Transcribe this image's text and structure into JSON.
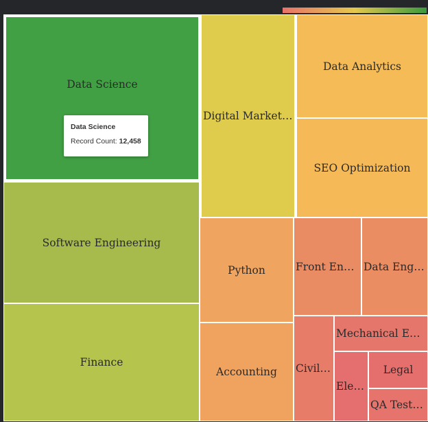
{
  "colors": {
    "background": "#252629",
    "legend_gradient": [
      "#e8736a",
      "#e5c84c",
      "#3b9a3e"
    ]
  },
  "chart_data": {
    "type": "treemap",
    "metric": "Record Count",
    "legend": "color-scale",
    "tiles": [
      {
        "label": "Data Science",
        "color": "#42a044",
        "selected": true
      },
      {
        "label": "Software Engineering",
        "color": "#a6bb4b"
      },
      {
        "label": "Finance",
        "color": "#b5c44c"
      },
      {
        "label": "Digital Marketing",
        "color": "#dfcc4d"
      },
      {
        "label": "Data Analytics",
        "color": "#f5bb57"
      },
      {
        "label": "SEO Optimization",
        "color": "#f5b958"
      },
      {
        "label": "Python",
        "color": "#efa45f"
      },
      {
        "label": "Accounting",
        "color": "#efa35f"
      },
      {
        "label": "Front End D...",
        "color": "#ea8c63"
      },
      {
        "label": "Data Engin...",
        "color": "#eb8d63"
      },
      {
        "label": "Civil E...",
        "color": "#e77d68"
      },
      {
        "label": "Mechanical Engin...",
        "color": "#e5766b"
      },
      {
        "label": "Elect...",
        "color": "#e56e6e"
      },
      {
        "label": "Legal",
        "color": "#e56f6d"
      },
      {
        "label": "QA Testing",
        "color": "#e6736c"
      }
    ]
  },
  "tooltip": {
    "title": "Data Science",
    "metric_label": "Record Count:",
    "metric_value": "12,458"
  }
}
